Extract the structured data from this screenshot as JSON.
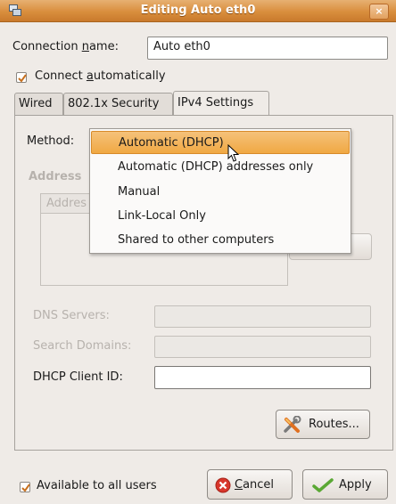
{
  "window": {
    "title": "Editing Auto eth0",
    "close_glyph": "×"
  },
  "connection_name": {
    "label_pre": "Connection ",
    "label_mn": "n",
    "label_post": "ame:",
    "value": "Auto eth0"
  },
  "connect_auto": {
    "label_pre": "Connect ",
    "label_mn": "a",
    "label_post": "utomatically",
    "checked": true
  },
  "tabs": [
    {
      "label": "Wired"
    },
    {
      "label": "802.1x Security"
    },
    {
      "label": "IPv4 Settings",
      "active": true
    }
  ],
  "ipv4": {
    "method_label": "Method:",
    "addresses_heading": "Address",
    "addresses_column": "Addres",
    "dns_servers_label": "DNS Servers:",
    "search_domains_label": "Search Domains:",
    "dhcp_client_id_label": "DHCP Client ID:",
    "routes_button": "Routes..."
  },
  "method_menu": {
    "items": [
      {
        "label": "Automatic (DHCP)",
        "selected": true
      },
      {
        "label": "Automatic (DHCP) addresses only"
      },
      {
        "label": "Manual"
      },
      {
        "label": "Link-Local Only"
      },
      {
        "label": "Shared to other computers"
      }
    ]
  },
  "footer": {
    "available_all_users": "Available to all users",
    "available_checked": true,
    "cancel_mn": "C",
    "cancel_rest": "ancel",
    "apply": "Apply"
  },
  "colors": {
    "accent": "#f0a843",
    "titlebar": "#d98e3d",
    "cancel_icon": "#d8362b",
    "apply_icon": "#5aa834"
  }
}
